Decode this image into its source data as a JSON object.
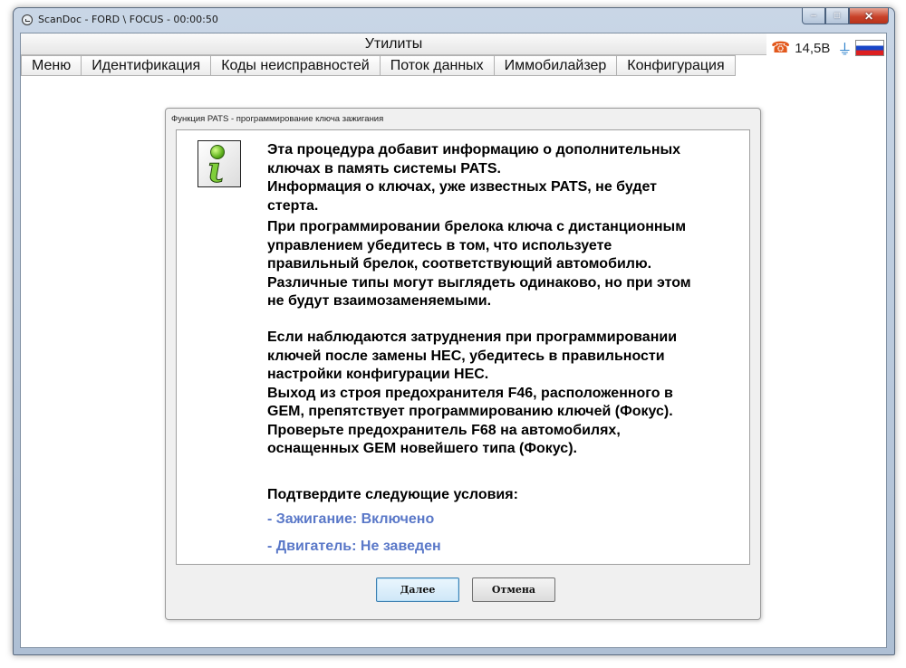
{
  "window": {
    "title": "ScanDoc - FORD \\ FOCUS - 00:00:50",
    "minimize_label": "–",
    "maximize_label": "□",
    "close_label": "✕"
  },
  "toolbar": {
    "section_title": "Утилиты",
    "voltage": "14,5B"
  },
  "tabs": [
    {
      "label": "Меню"
    },
    {
      "label": "Идентификация"
    },
    {
      "label": "Коды неисправностей"
    },
    {
      "label": "Поток данных"
    },
    {
      "label": "Иммобилайзер"
    },
    {
      "label": "Конфигурация"
    }
  ],
  "dialog": {
    "title": "Функция PATS - программирование ключа зажигания",
    "paragraph1": "Эта процедура добавит информацию о дополнительных\nключах в память системы PATS.\nИнформация о ключах, уже известных PATS, не будет\nстерта.",
    "paragraph2": "При программировании брелока ключа с дистанционным\nуправлением убедитесь в том, что используете\nправильный брелок, соответствующий автомобилю.\nРазличные типы могут выглядеть одинаково, но при этом\nне будут взаимозаменяемыми.",
    "paragraph3": "Если наблюдаются затруднения при программировании\nключей после замены HEC, убедитесь в правильности\nнастройки конфигурации HEC.\nВыход из строя предохранителя F46, расположенного в\nGEM, препятствует программированию ключей (Фокус).\nПроверьте предохранитель F68 на автомобилях,\nоснащенных GEM новейшего типа (Фокус).",
    "confirm_heading": "Подтвердите следующие условия:",
    "conditions": [
      "- Зажигание: Включено",
      "- Двигатель: Не заведен"
    ],
    "next_button": "Далее",
    "cancel_button": "Отмена"
  },
  "icons": {
    "app": "app-icon",
    "phone": "phone-icon",
    "plug": "plug-icon",
    "flag": "russia-flag-icon",
    "info": "info-icon"
  },
  "colors": {
    "condition_text": "#5a78c8",
    "phone_icon": "#e2581c",
    "close_button": "#c9432a"
  }
}
